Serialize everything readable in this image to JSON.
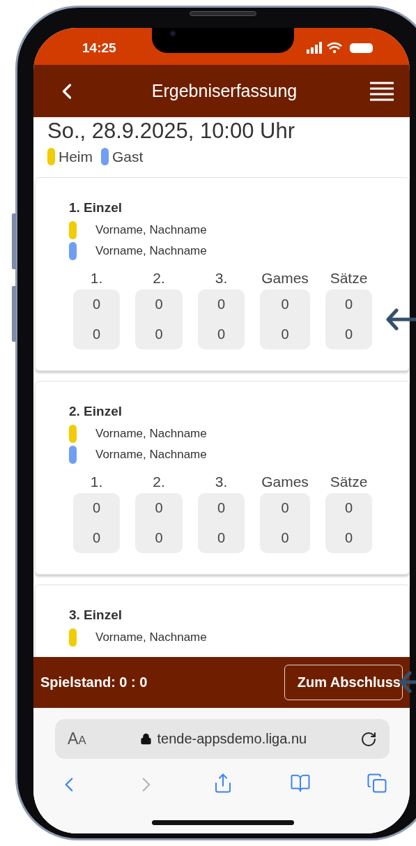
{
  "status_bar": {
    "time": "14:25"
  },
  "header": {
    "title": "Ergebniserfassung"
  },
  "date": "So., 28.9.2025, 10:00 Uhr",
  "legend": [
    {
      "label": "Heim",
      "color": "#f2cb00"
    },
    {
      "label": "Gast",
      "color": "#6f9ef6"
    }
  ],
  "matches": [
    {
      "title": "1. Einzel",
      "players": [
        {
          "name": "Vorname, Nachname",
          "color": "#f2cb00"
        },
        {
          "name": "Vorname, Nachname",
          "color": "#6f9ef6"
        }
      ],
      "columns": [
        "1.",
        "2.",
        "3.",
        "Games",
        "Sätze"
      ],
      "scores": [
        [
          "0",
          "0"
        ],
        [
          "0",
          "0"
        ],
        [
          "0",
          "0"
        ],
        [
          "0",
          "0"
        ],
        [
          "0",
          "0"
        ]
      ]
    },
    {
      "title": "2. Einzel",
      "players": [
        {
          "name": "Vorname, Nachname",
          "color": "#f2cb00"
        },
        {
          "name": "Vorname, Nachname",
          "color": "#6f9ef6"
        }
      ],
      "columns": [
        "1.",
        "2.",
        "3.",
        "Games",
        "Sätze"
      ],
      "scores": [
        [
          "0",
          "0"
        ],
        [
          "0",
          "0"
        ],
        [
          "0",
          "0"
        ],
        [
          "0",
          "0"
        ],
        [
          "0",
          "0"
        ]
      ]
    },
    {
      "title": "3. Einzel",
      "players": [
        {
          "name": "Vorname, Nachname",
          "color": "#f2cb00"
        }
      ]
    }
  ],
  "footer": {
    "score": "Spielstand: 0 : 0",
    "button": "Zum Abschluss"
  },
  "browser": {
    "text_size": "AA",
    "url": "tende-appsdemo.liga.nu"
  },
  "browser_toolbar": [
    {
      "kind": "back",
      "disabled": false
    },
    {
      "kind": "forward",
      "disabled": true
    },
    {
      "kind": "share",
      "disabled": false
    },
    {
      "kind": "bookmarks",
      "disabled": false
    },
    {
      "kind": "tabs",
      "disabled": false
    }
  ]
}
